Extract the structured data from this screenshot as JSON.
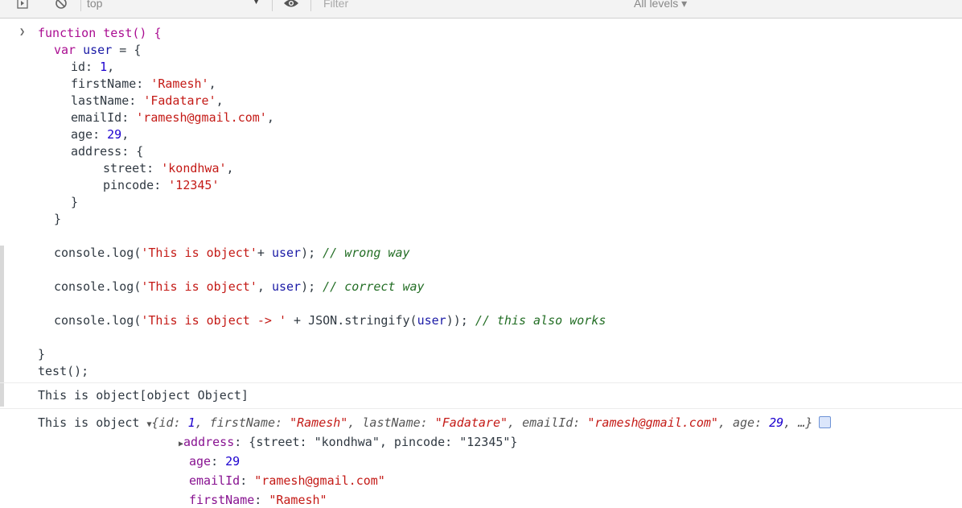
{
  "toolbar": {
    "context": "top",
    "filter_placeholder": "Filter",
    "levels": "All levels ▾"
  },
  "code": {
    "l1": "function test() {",
    "l2_kw": "var",
    "l2_var": "user",
    "l2_rest": " = {",
    "l3_key": "id: ",
    "l3_val": "1",
    "l3_end": ",",
    "l4_key": "firstName: ",
    "l4_val": "'Ramesh'",
    "l4_end": ",",
    "l5_key": "lastName: ",
    "l5_val": "'Fadatare'",
    "l5_end": ",",
    "l6_key": "emailId: ",
    "l6_val": "'ramesh@gmail.com'",
    "l6_end": ",",
    "l7_key": "age: ",
    "l7_val": "29",
    "l7_end": ",",
    "l8": "address: {",
    "l9_key": "street: ",
    "l9_val": "'kondhwa'",
    "l9_end": ",",
    "l10_key": "pincode: ",
    "l10_val": "'12345'",
    "l11": "}",
    "l12": "}",
    "l13_a": "console.log(",
    "l13_str": "'This is object'",
    "l13_b": "+ ",
    "l13_var": "user",
    "l13_c": "); ",
    "l13_cmt": "// wrong way",
    "l14_a": "console.log(",
    "l14_str": "'This is object'",
    "l14_b": ", ",
    "l14_var": "user",
    "l14_c": "); ",
    "l14_cmt": "// correct way",
    "l15_a": "console.log(",
    "l15_str": "'This is object -> '",
    "l15_b": " + JSON.stringify(",
    "l15_var": "user",
    "l15_c": ")); ",
    "l15_cmt": "// this also works",
    "l16": "}",
    "l17": "test();"
  },
  "output": {
    "row1": "This is object[object Object]",
    "row2_label": "This is object ",
    "row2_open": "{",
    "row2_k1": "id: ",
    "row2_v1": "1",
    "row2_k2": ", firstName: ",
    "row2_v2": "\"Ramesh\"",
    "row2_k3": ", lastName: ",
    "row2_v3": "\"Fadatare\"",
    "row2_k4": ", emailId: ",
    "row2_v4": "\"ramesh@gmail.com\"",
    "row2_k5": ", age: ",
    "row2_v5": "29",
    "row2_close": ", …}",
    "address_key": "address",
    "address_val": ": {street: \"kondhwa\", pincode: \"12345\"}",
    "age_key": "age",
    "age_val": "29",
    "email_key": "emailId",
    "email_val": "\"ramesh@gmail.com\"",
    "first_key": "firstName",
    "first_val": "\"Ramesh\""
  }
}
